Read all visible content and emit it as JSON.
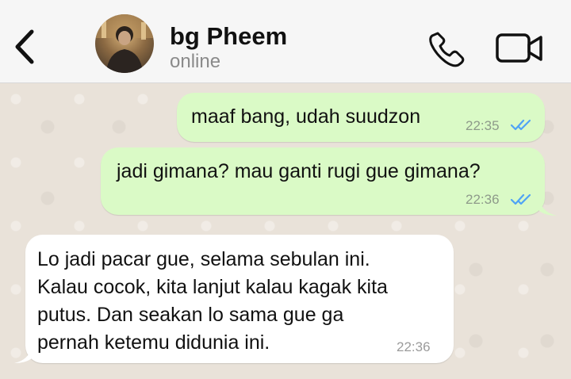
{
  "header": {
    "contact_name": "bg Pheem",
    "status": "online"
  },
  "messages": [
    {
      "direction": "out",
      "text": "maaf bang, udah suudzon",
      "time": "22:35",
      "read": true
    },
    {
      "direction": "out",
      "text": "jadi gimana? mau ganti rugi gue gimana?",
      "time": "22:36",
      "read": true
    },
    {
      "direction": "in",
      "lines": [
        "Lo jadi pacar gue, selama sebulan ini.",
        "Kalau cocok, kita lanjut kalau kagak kita",
        "putus. Dan seakan lo sama gue ga",
        "pernah ketemu didunia ini."
      ],
      "time": "22:36"
    }
  ],
  "colors": {
    "outgoing_bubble": "#dafac6",
    "incoming_bubble": "#ffffff",
    "read_ticks": "#4fa3f5"
  }
}
